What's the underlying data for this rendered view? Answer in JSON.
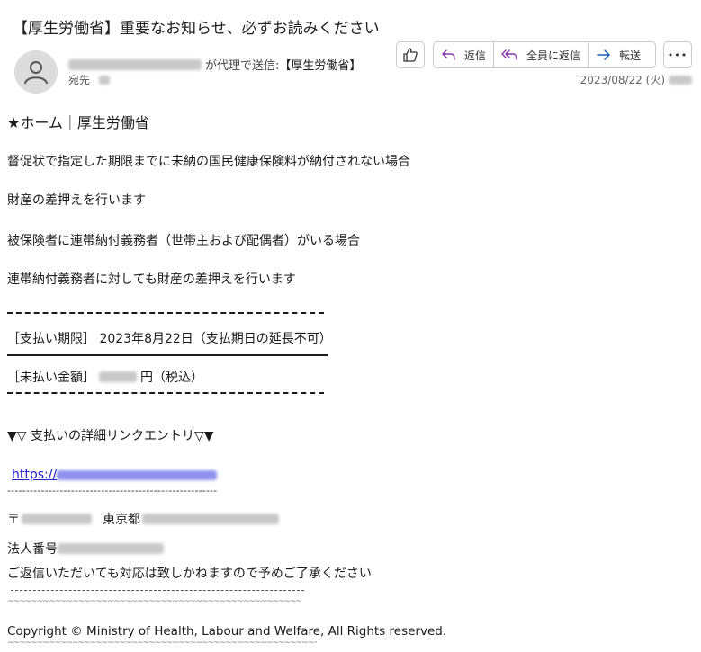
{
  "email": {
    "subject": "【厚生労働省】重要なお知らせ、必ずお読みください",
    "sender_via": "が代理で送信:",
    "sender_name": "【厚生労働省】",
    "to_label": "宛先",
    "date": "2023/08/22 (火)"
  },
  "toolbar": {
    "reply_label": "返信",
    "reply_all_label": "全員に返信",
    "forward_label": "転送",
    "more_label": "•••"
  },
  "body": {
    "line1": "★ホーム｜厚生労働省",
    "line2": "督促状で指定した期限までに未納の国民健康保険料が納付されない場合",
    "line3": "財産の差押えを行います",
    "line4": "被保険者に連帯納付義務者（世帯主および配偶者）がいる場合",
    "line5": "連帯納付義務者に対しても財産の差押えを行います",
    "deadline": "［支払い期限］ 2023年8月22日（支払期日の延長不可）",
    "amount_label": "［未払い金額］",
    "amount_suffix": "円（税込）",
    "details_heading": "▼▽ 支払いの詳細リンクエントリ▽▼",
    "link_prefix": "https://",
    "separator": "--------------------------------------------------------",
    "postal_mark": "〒",
    "address_city": "東京都",
    "corp_number_label": "法人番号",
    "no_reply_note": "ご返信いただいても対応は致しかねますので予めご了承ください",
    "copyright": "Copyright © Ministry of Health, Labour and Welfare, All Rights reserved.",
    "wave": "~~~~~~~~~~~~~~~~~~~~~~~~~~~~~~~~~~~~~~~~~~~~~~~~~~~~~~~~~~~~~~~~~~~~~~~~~~~~~~~~~~~~"
  }
}
